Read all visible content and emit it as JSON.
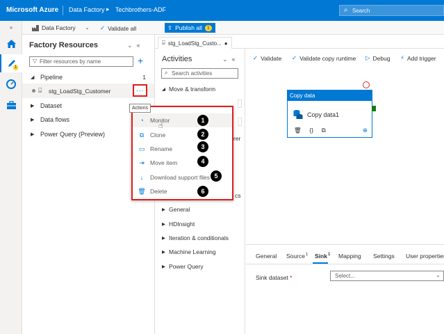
{
  "topbar": {
    "brand": "Microsoft Azure",
    "crumb1": "Data Factory",
    "crumb_sep": "▸",
    "crumb2": "Techbrothers-ADF",
    "search_placeholder": "Search"
  },
  "toolbar": {
    "factory_label": "Data Factory",
    "validate_all": "Validate all",
    "publish_all": "Publish all",
    "publish_count": "1"
  },
  "rail": {
    "badge": "1"
  },
  "factory_resources": {
    "title": "Factory Resources",
    "filter_placeholder": "Filter resources by name",
    "pipeline": {
      "label": "Pipeline",
      "count": "1",
      "item": "stg_LoadStg_Customer"
    },
    "dataset": "Dataset",
    "dataflows": "Data flows",
    "powerquery": "Power Query (Preview)"
  },
  "actions_tooltip": "Actions",
  "context_menu": [
    {
      "label": "Monitor",
      "icon": "monitor-icon",
      "num": "1"
    },
    {
      "label": "Clone",
      "icon": "clone-icon",
      "num": "2"
    },
    {
      "label": "Rename",
      "icon": "rename-icon",
      "num": "3"
    },
    {
      "label": "Move item",
      "icon": "move-icon",
      "num": "4"
    },
    {
      "label": "Download support files",
      "icon": "download-icon",
      "num": "5"
    },
    {
      "label": "Delete",
      "icon": "delete-icon",
      "num": "6"
    }
  ],
  "tab": {
    "label": "stg_LoadStg_Custo..."
  },
  "activities": {
    "title": "Activities",
    "search_placeholder": "Search activities",
    "move_transform": "Move & transform",
    "partial_rer": "rer",
    "partial_ics": "cs",
    "categories": [
      "General",
      "HDInsight",
      "Iteration & conditionals",
      "Machine Learning",
      "Power Query"
    ]
  },
  "canvas_toolbar": {
    "validate": "Validate",
    "validate_copy": "Validate copy runtime",
    "debug": "Debug",
    "add_trigger": "Add trigger"
  },
  "copy_node": {
    "header": "Copy data",
    "name": "Copy data1"
  },
  "properties": {
    "tabs": [
      {
        "label": "General",
        "sup": ""
      },
      {
        "label": "Source",
        "sup": "1"
      },
      {
        "label": "Sink",
        "sup": "1"
      },
      {
        "label": "Mapping",
        "sup": ""
      },
      {
        "label": "Settings",
        "sup": ""
      },
      {
        "label": "User properties",
        "sup": ""
      }
    ],
    "sink_dataset_label": "Sink dataset",
    "required_mark": "*",
    "sink_select": "Select..."
  }
}
